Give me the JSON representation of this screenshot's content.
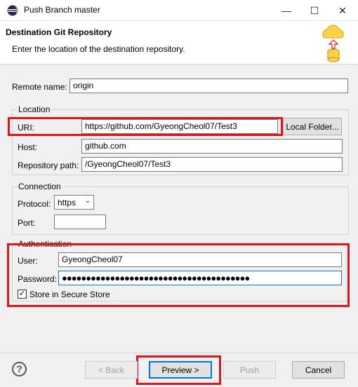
{
  "window": {
    "title": "Push Branch master",
    "minimize_glyph": "—",
    "maximize_glyph": "☐",
    "close_glyph": "✕"
  },
  "banner": {
    "title": "Destination Git Repository",
    "message": "Enter the location of the destination repository."
  },
  "remote": {
    "label": "Remote name:",
    "value": "origin"
  },
  "location": {
    "group_label": "Location",
    "uri_label": "URI:",
    "uri_value": "https://github.com/GyeongCheol07/Test3",
    "local_folder_button": "Local Folder...",
    "host_label": "Host:",
    "host_value": "github.com",
    "repo_path_label": "Repository path:",
    "repo_path_value": "/GyeongCheol07/Test3"
  },
  "connection": {
    "group_label": "Connection",
    "protocol_label": "Protocol:",
    "protocol_value": "https",
    "port_label": "Port:",
    "port_value": ""
  },
  "authentication": {
    "group_label": "Authentication",
    "user_label": "User:",
    "user_value": "GyeongCheol07",
    "password_label": "Password:",
    "password_value": "●●●●●●●●●●●●●●●●●●●●●●●●●●●●●●●●●●●●●●●",
    "store_label": "Store in Secure Store",
    "store_checked": true,
    "check_glyph": "✓"
  },
  "footer": {
    "help_glyph": "?",
    "back_button": "< Back",
    "preview_button": "Preview >",
    "push_button": "Push",
    "cancel_button": "Cancel"
  },
  "colors": {
    "highlight_box": "#e0141b",
    "default_button_border": "#0078d7"
  },
  "icons": {
    "app": "eclipse-icon",
    "wizard": "cloud-push-database-icon"
  }
}
